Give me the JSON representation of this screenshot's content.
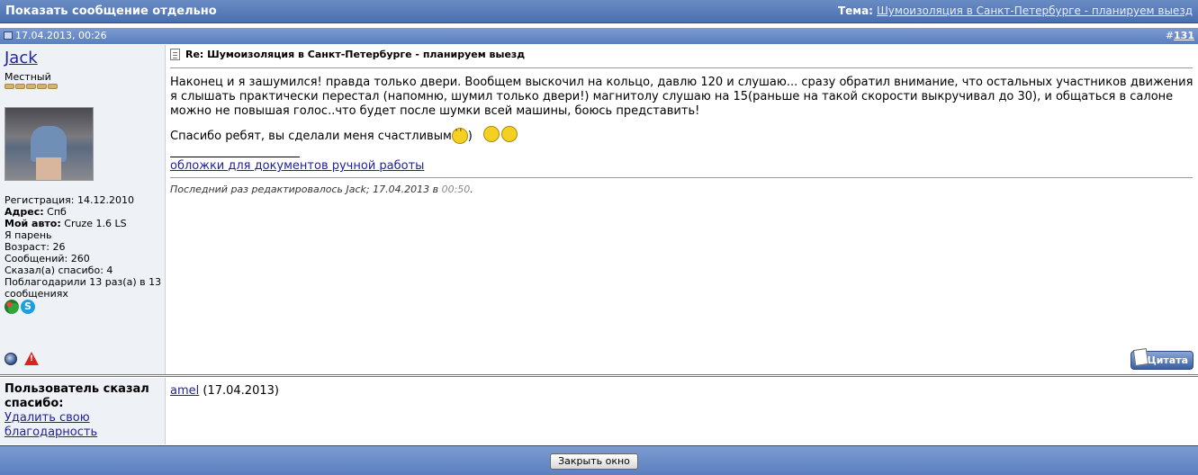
{
  "title_bar": {
    "title": "Показать сообщение отдельно",
    "topic_label": "Тема:",
    "topic_link": "Шумоизоляция в Санкт-Петербурге - планируем выезд"
  },
  "post_header": {
    "date": "17.04.2013, 00:26",
    "hash": "#",
    "post_number": "131"
  },
  "user": {
    "name": "Jack",
    "title": "Местный",
    "stars": 5,
    "details": {
      "registration": "Регистрация: 14.12.2010",
      "address_label": "Адрес:",
      "address_value": " Спб",
      "car_label": "Мой авто:",
      "car_value": " Cruze 1.6 LS",
      "gender": "Я парень",
      "age": "Возраст: 26",
      "posts": "Сообщений: 260",
      "said_thanks": "Сказал(а) спасибо: 4",
      "thanked": "Поблагодарили 13 раз(а) в 13 сообщениях"
    },
    "im_icons": [
      "clover-icon",
      "skype-icon"
    ]
  },
  "post": {
    "title": "Re: Шумоизоляция в Санкт-Петербурге - планируем выезд",
    "message": "Наконец и я зашумился! правда только двери. Вообщем выскочил на кольцо, давлю 120 и слушаю... сразу обратил внимание, что остальных участников движения я слышать практически перестал (напомню, шумил только двери!) магнитолу слушаю на 15(раньше на такой скорости выкручивал до 30), и общаться в салоне можно не повышая голос..что будет после шумки всей машины, боюсь представить!",
    "thanks_text": "Спасибо ребят, вы сделали меня счастливым",
    "thanks_paren": ")",
    "signature_link": "обложки для документов ручной работы",
    "edited_prefix": "Последний раз редактировалось Jack; 17.04.2013 в ",
    "edited_time": "00:50",
    "edited_suffix": ".",
    "quote_button": "Цитата"
  },
  "thanks_block": {
    "label": "Пользователь сказал спасибо:",
    "remove_link": "Удалить свою благодарность",
    "user_link": "amel",
    "date": " (17.04.2013)"
  },
  "footer": {
    "close_button": "Закрыть окно"
  }
}
